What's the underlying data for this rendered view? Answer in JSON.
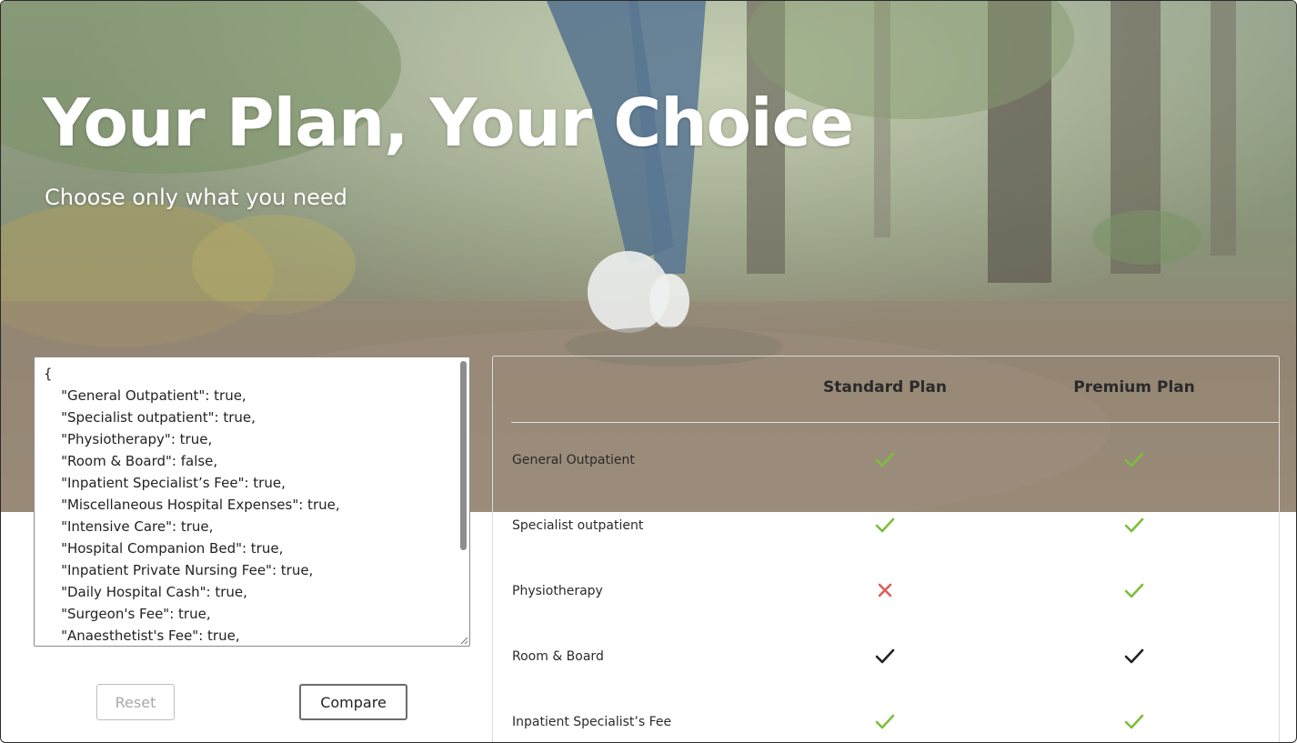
{
  "colors": {
    "check_green": "#7cbf3b",
    "cross_red": "#e05b5b",
    "check_dark": "#222222",
    "hero_overlay": "rgba(255,255,255,0.35)"
  },
  "hero": {
    "title": "Your Plan, Your Choice",
    "subtitle": "Choose only what you need"
  },
  "json_input": {
    "lines": [
      "{",
      "    \"General Outpatient\": true,",
      "    \"Specialist outpatient\": true,",
      "    \"Physiotherapy\": true,",
      "    \"Room & Board\": false,",
      "    \"Inpatient Specialist’s Fee\": true,",
      "    \"Miscellaneous Hospital Expenses\": true,",
      "    \"Intensive Care\": true,",
      "    \"Hospital Companion Bed\": true,",
      "    \"Inpatient Private Nursing Fee\": true,",
      "    \"Daily Hospital Cash\": true,",
      "    \"Surgeon's Fee\": true,",
      "    \"Anaesthetist's Fee\": true,"
    ]
  },
  "buttons": {
    "reset_label": "Reset",
    "compare_label": "Compare"
  },
  "comparison": {
    "columns": [
      "Standard Plan",
      "Premium Plan"
    ],
    "rows": [
      {
        "label": "General Outpatient",
        "standard": "check-green",
        "premium": "check-green"
      },
      {
        "label": "Specialist outpatient",
        "standard": "check-green",
        "premium": "check-green"
      },
      {
        "label": "Physiotherapy",
        "standard": "cross-red",
        "premium": "check-green"
      },
      {
        "label": "Room & Board",
        "standard": "check-dark",
        "premium": "check-dark"
      },
      {
        "label": "Inpatient Specialist’s Fee",
        "standard": "check-green",
        "premium": "check-green"
      }
    ]
  }
}
